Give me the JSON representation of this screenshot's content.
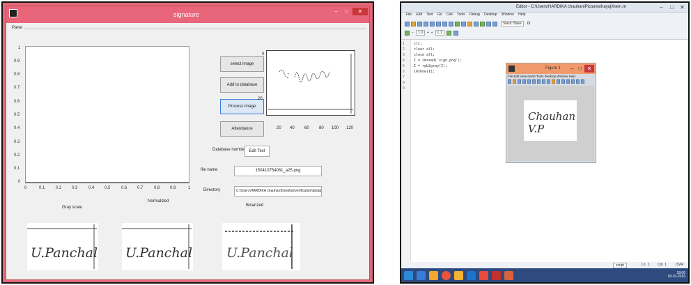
{
  "left": {
    "window_title": "signature",
    "panel_label": "Panel",
    "yticks": [
      "1",
      "0.9",
      "0.8",
      "0.7",
      "0.6",
      "0.5",
      "0.4",
      "0.3",
      "0.2",
      "0.1",
      "0"
    ],
    "xticks": [
      "0",
      "0.1",
      "0.2",
      "0.3",
      "0.4",
      "0.5",
      "0.6",
      "0.7",
      "0.8",
      "0.9",
      "1"
    ],
    "buttons": {
      "select_image": "select image",
      "add_to_database": "Add to database",
      "process_image": "Process image",
      "attendance": "Attendance"
    },
    "image_axes": {
      "ytick_top": "0",
      "ytick_mid": "20",
      "xticks": [
        "20",
        "40",
        "60",
        "80",
        "100",
        "120"
      ]
    },
    "database_number_label": "Database number",
    "database_number_value": "Edit Text",
    "file_name_label": "file name",
    "file_name_value": "150410754061_a25.png",
    "directory_label": "Directory",
    "directory_value": "C:\\Users\\HARDIKA chauhan\\Desktop\\verification\\databa",
    "captions": {
      "gray": "Gray scale",
      "normalized": "Normalized",
      "binarized": "Binarized"
    },
    "signatures": [
      "U.Panchal",
      "U.Panchal",
      "U.Panchal"
    ]
  },
  "right": {
    "window_title": "Editor - C:\\Users\\HARDIKA chauhan\\Pictures\\hayuji\\hern.m",
    "menu": [
      "File",
      "Edit",
      "Text",
      "Go",
      "Cell",
      "Tools",
      "Debug",
      "Desktop",
      "Window",
      "Help"
    ],
    "toolbar_stack": "Stack: Base",
    "toolbar_fx": "fx",
    "cell_value": "1.0",
    "cell_divisor": "1.1",
    "line_numbers": [
      "1",
      "2",
      "3",
      "4",
      "5",
      "6",
      "7",
      "8",
      "9"
    ],
    "code_lines": [
      "clc;",
      "clear all;",
      "close all;",
      "I = imread('sign.png');",
      "I = rgb2gray(I);",
      "imshow(I);"
    ],
    "figure": {
      "title": "Figure 1",
      "menu": "File  Edit  View  Insert  Tools  Desktop  Window  Help",
      "signature": "Chauhan V.P"
    },
    "status": {
      "mode": "script",
      "ln_label": "Ln",
      "ln": "1",
      "col_label": "Col",
      "col": "1",
      "ovr": "OVR"
    },
    "clock": {
      "time": "18:06",
      "date": "18-10-2016"
    }
  },
  "colors": {
    "accent_pink": "#e8657a",
    "figure_title": "#f09a6c",
    "taskbar": "#2e4a7e"
  }
}
